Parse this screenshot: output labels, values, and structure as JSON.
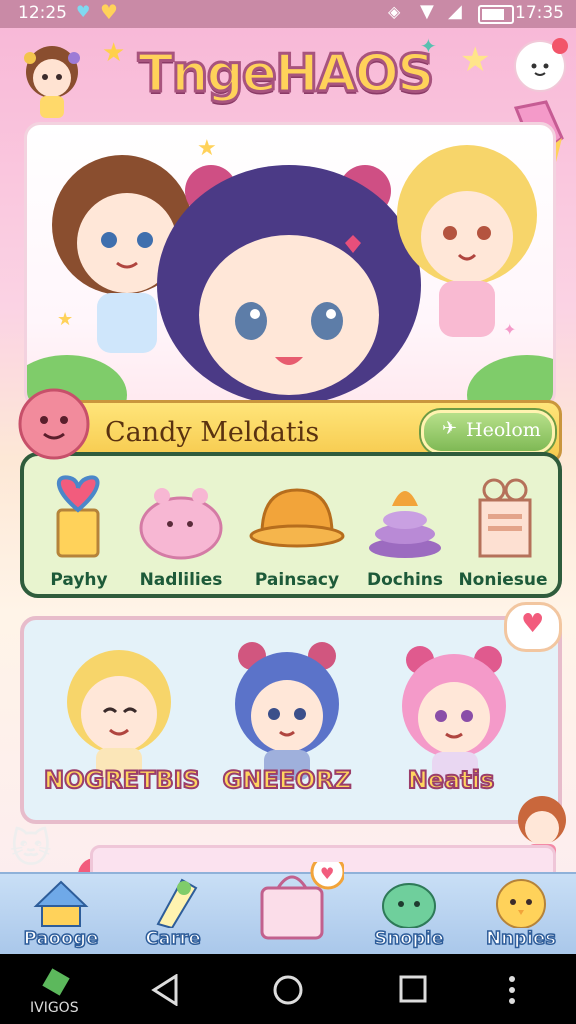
{
  "status_bar": {
    "time_left": "12:25",
    "time_right": "17:35"
  },
  "app_title": "TngeHAOS",
  "featured": {
    "banner_text": "Candy Meldatis",
    "enter_button": "Heolom"
  },
  "categories": [
    {
      "label": "Payhy",
      "icon": "heart-frame-icon",
      "color": "#6fb0e8"
    },
    {
      "label": "Nadlilies",
      "icon": "cake-icon",
      "color": "#f7a9cc"
    },
    {
      "label": "Painsacy",
      "icon": "pudding-icon",
      "color": "#f2a43a"
    },
    {
      "label": "Dochins",
      "icon": "swirl-cake-icon",
      "color": "#b98ad6"
    },
    {
      "label": "Noniesue",
      "icon": "gift-box-icon",
      "color": "#f3b9a2"
    }
  ],
  "characters": [
    {
      "name": "NOGRETBIS",
      "hair": "#f7d56a"
    },
    {
      "name": "GNEEORZ",
      "hair": "#5b73c9"
    },
    {
      "name": "Neatis",
      "hair": "#f49ac9"
    }
  ],
  "bottom_nav": [
    {
      "label": "Paooge",
      "icon": "house-icon"
    },
    {
      "label": "Carre",
      "icon": "ticket-icon"
    },
    {
      "label": "Snopie",
      "icon": "slime-icon"
    },
    {
      "label": "Nnpies",
      "icon": "chick-icon"
    }
  ],
  "android_nav": {
    "label": "IVIGOS"
  }
}
